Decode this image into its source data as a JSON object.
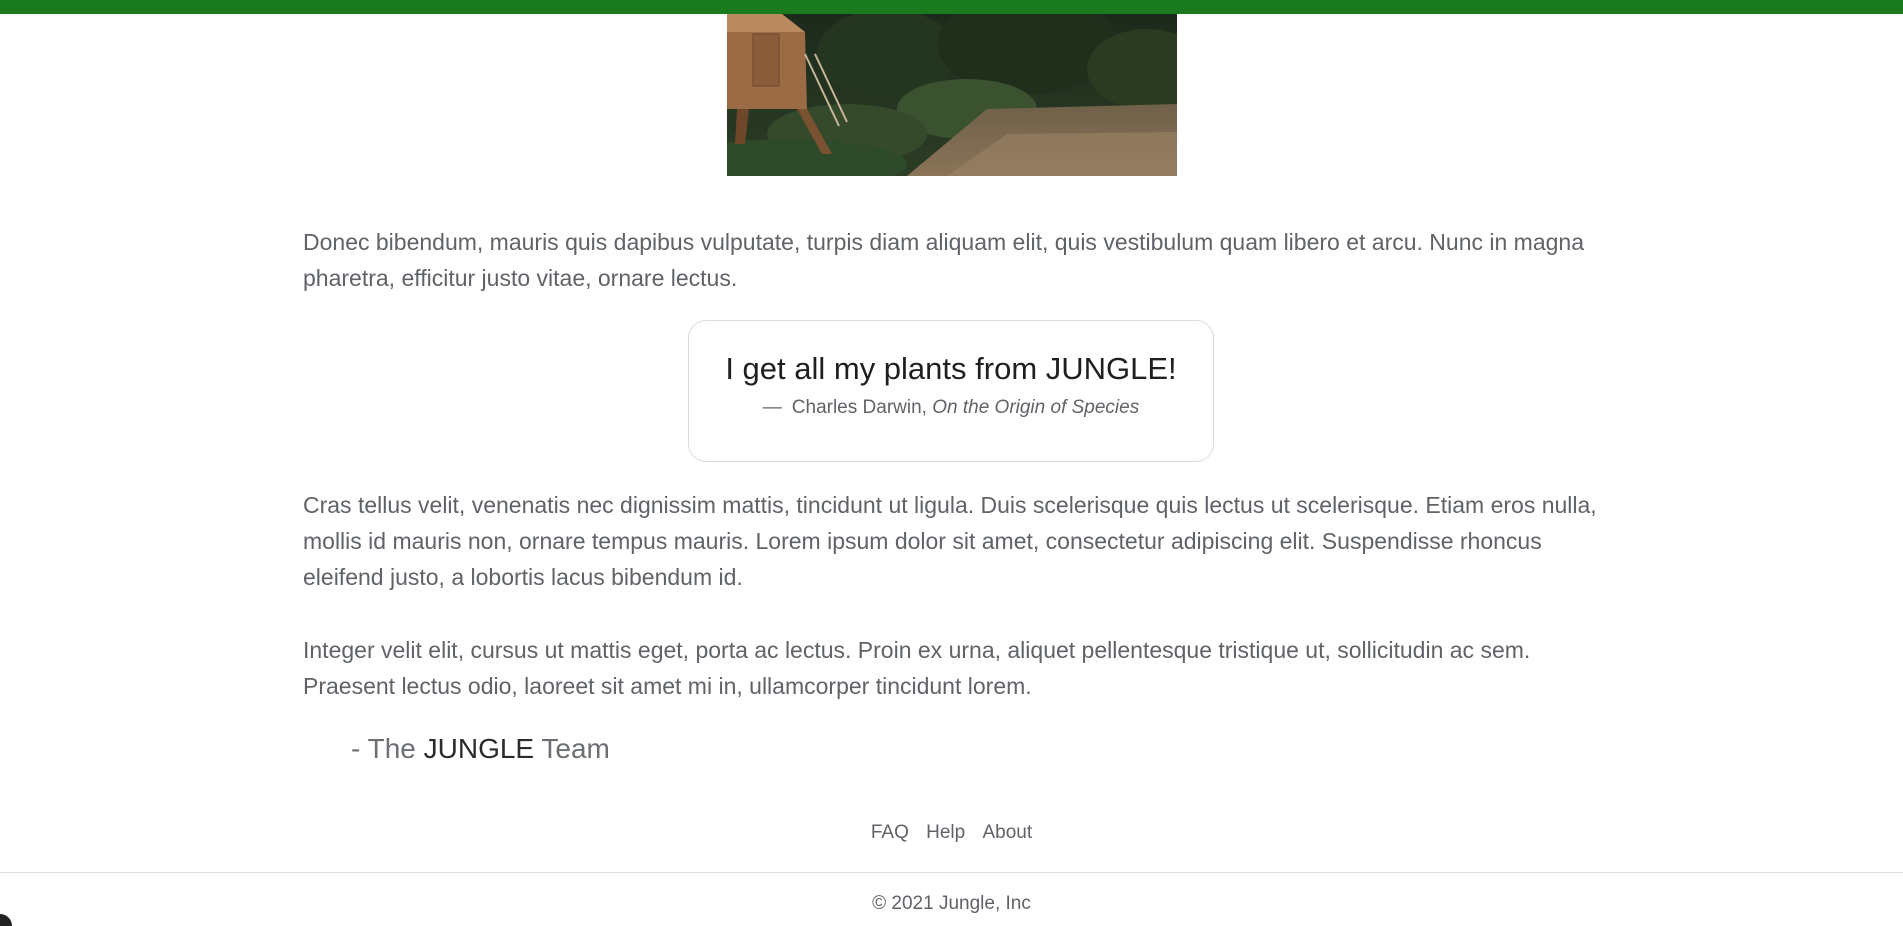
{
  "colors": {
    "accent": "#1a7a1e",
    "text": "#5f6368",
    "quote_border": "#dcdcdc"
  },
  "hero": {
    "alt": "Wooden garden shed beside a gravel path and green shrubs"
  },
  "content": {
    "paragraph_1": "Donec bibendum, mauris quis dapibus vulputate, turpis diam aliquam elit, quis vestibulum quam libero et arcu. Nunc in magna pharetra, efficitur justo vitae, ornare lectus.",
    "quote": {
      "text": "I get all my plants from JUNGLE!",
      "dash": "—",
      "author": "Charles Darwin,",
      "work": "On the Origin of Species"
    },
    "paragraph_2": "Cras tellus velit, venenatis nec dignissim mattis, tincidunt ut ligula. Duis scelerisque quis lectus ut scelerisque. Etiam eros nulla, mollis id mauris non, ornare tempus mauris. Lorem ipsum dolor sit amet, consectetur adipiscing elit. Suspendisse rhoncus eleifend justo, a lobortis lacus bibendum id.",
    "paragraph_3": "Integer velit elit, cursus ut mattis eget, porta ac lectus. Proin ex urna, aliquet pellentesque tristique ut, sollicitudin ac sem. Praesent lectus odio, laoreet sit amet mi in, ullamcorper tincidunt lorem.",
    "signoff": {
      "prefix": "- The ",
      "brand": "JUNGLE",
      "suffix": " Team"
    }
  },
  "footer": {
    "links": [
      "FAQ",
      "Help",
      "About"
    ],
    "copyright": "© 2021 Jungle, Inc"
  }
}
